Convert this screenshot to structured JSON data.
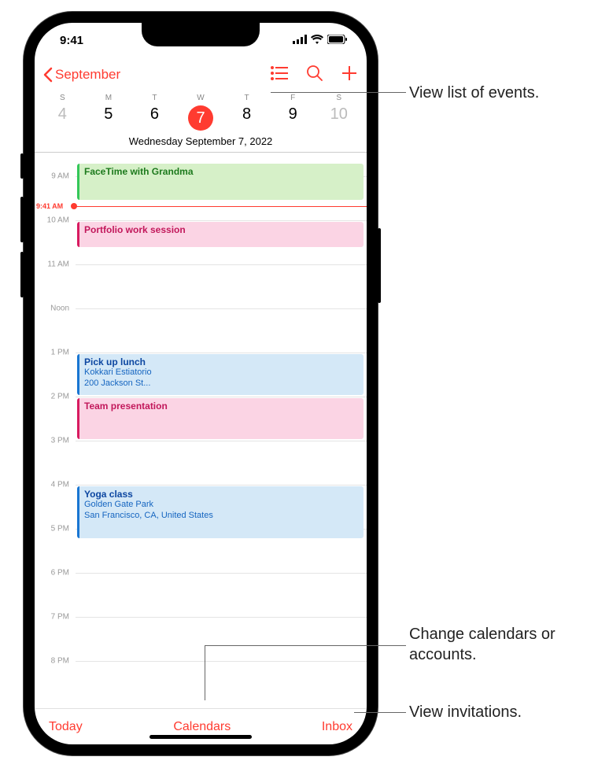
{
  "status": {
    "time": "9:41"
  },
  "nav": {
    "back_label": "September"
  },
  "week": {
    "letters": [
      "S",
      "M",
      "T",
      "W",
      "T",
      "F",
      "S"
    ],
    "numbers": [
      "4",
      "5",
      "6",
      "7",
      "8",
      "9",
      "10"
    ],
    "selected_index": 3,
    "date_label": "Wednesday  September 7, 2022"
  },
  "timeline": {
    "now_label": "9:41 AM",
    "hours": [
      "9 AM",
      "10 AM",
      "11 AM",
      "Noon",
      "1 PM",
      "2 PM",
      "3 PM",
      "4 PM",
      "5 PM",
      "6 PM",
      "7 PM",
      "8 PM"
    ]
  },
  "events": [
    {
      "title": "FaceTime with Grandma",
      "color": "green"
    },
    {
      "title": "Portfolio work session",
      "color": "pink"
    },
    {
      "title": "Pick up lunch",
      "sub1": "Kokkari Estiatorio",
      "sub2": "200 Jackson St...",
      "color": "blue"
    },
    {
      "title": "Team presentation",
      "color": "pink"
    },
    {
      "title": "Yoga class",
      "sub1": "Golden Gate Park",
      "sub2": "San Francisco, CA, United States",
      "color": "blue"
    }
  ],
  "toolbar": {
    "today": "Today",
    "calendars": "Calendars",
    "inbox": "Inbox"
  },
  "callouts": {
    "list": "View list of events.",
    "calendars": "Change calendars or accounts.",
    "inbox": "View invitations."
  }
}
